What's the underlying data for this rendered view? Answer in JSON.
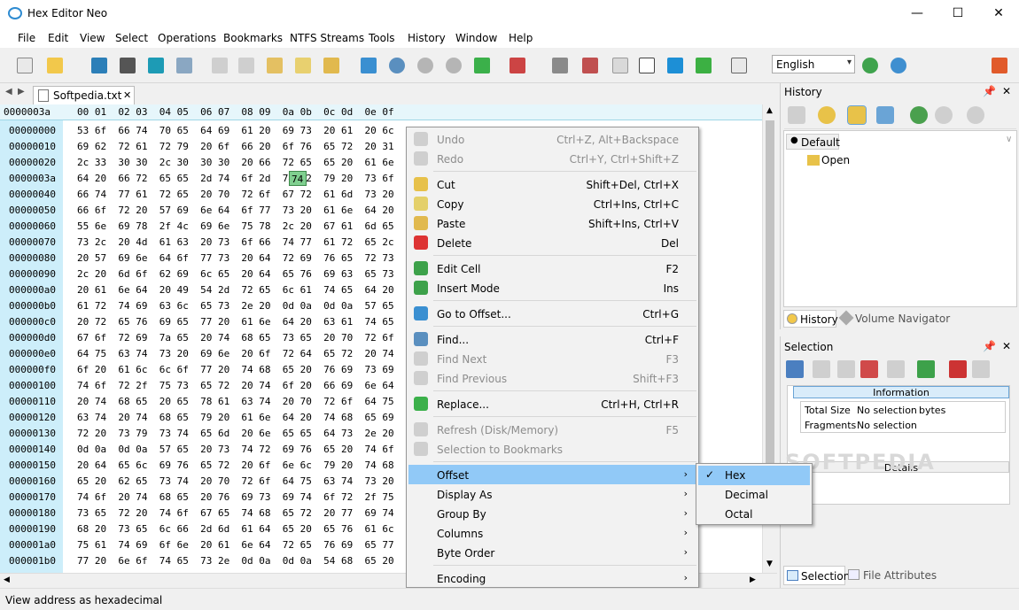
{
  "window": {
    "title": "Hex Editor Neo",
    "min": "—",
    "max": "☐",
    "close": "✕"
  },
  "menu": [
    "File",
    "Edit",
    "View",
    "Select",
    "Operations",
    "Bookmarks",
    "NTFS Streams",
    "Tools",
    "History",
    "Window",
    "Help"
  ],
  "toolbar": {
    "language": "English"
  },
  "tab": {
    "name": "Softpedia.txt",
    "close": "✕"
  },
  "hex_header": {
    "offset": "0000003a",
    "columns": "00 01  02 03  04 05  06 07  08 09  0a 0b  0c 0d  0e 0f"
  },
  "rows": [
    {
      "off": "00000000",
      "hex": "53 6f  66 74  70 65  64 69  61 20  69 73  20 61  20 6c"
    },
    {
      "off": "00000010",
      "hex": "69 62  72 61  72 79  20 6f  66 20  6f 76  65 72  20 31"
    },
    {
      "off": "00000020",
      "hex": "2c 33  30 30  2c 30  30 30  20 66  72 65  65 20  61 6e"
    },
    {
      "off": "0000003a",
      "hex": "64 20  66 72  65 65  2d 74  6f 2d  74 72  79 20  73 6f"
    },
    {
      "off": "00000040",
      "hex": "66 74  77 61  72 65  20 70  72 6f  67 72  61 6d  73 20"
    },
    {
      "off": "00000050",
      "hex": "66 6f  72 20  57 69  6e 64  6f 77  73 20  61 6e  64 20"
    },
    {
      "off": "00000060",
      "hex": "55 6e  69 78  2f 4c  69 6e  75 78  2c 20  67 61  6d 65"
    },
    {
      "off": "00000070",
      "hex": "73 2c  20 4d  61 63  20 73  6f 66  74 77  61 72  65 2c"
    },
    {
      "off": "00000080",
      "hex": "20 57  69 6e  64 6f  77 73  20 64  72 69  76 65  72 73"
    },
    {
      "off": "00000090",
      "hex": "2c 20  6d 6f  62 69  6c 65  20 64  65 76  69 63  65 73"
    },
    {
      "off": "000000a0",
      "hex": "20 61  6e 64  20 49  54 2d  72 65  6c 61  74 65  64 20"
    },
    {
      "off": "000000b0",
      "hex": "61 72  74 69  63 6c  65 73  2e 20  0d 0a  0d 0a  57 65"
    },
    {
      "off": "000000c0",
      "hex": "20 72  65 76  69 65  77 20  61 6e  64 20  63 61  74 65"
    },
    {
      "off": "000000d0",
      "hex": "67 6f  72 69  7a 65  20 74  68 65  73 65  20 70  72 6f"
    },
    {
      "off": "000000e0",
      "hex": "64 75  63 74  73 20  69 6e  20 6f  72 64  65 72  20 74"
    },
    {
      "off": "000000f0",
      "hex": "6f 20  61 6c  6c 6f  77 20  74 68  65 20  76 69  73 69"
    },
    {
      "off": "00000100",
      "hex": "74 6f  72 2f  75 73  65 72  20 74  6f 20  66 69  6e 64"
    },
    {
      "off": "00000110",
      "hex": "20 74  68 65  20 65  78 61  63 74  20 70  72 6f  64 75"
    },
    {
      "off": "00000120",
      "hex": "63 74  20 74  68 65  79 20  61 6e  64 20  74 68  65 69"
    },
    {
      "off": "00000130",
      "hex": "72 20  73 79  73 74  65 6d  20 6e  65 65  64 73  2e 20"
    },
    {
      "off": "00000140",
      "hex": "0d 0a  0d 0a  57 65  20 73  74 72  69 76  65 20  74 6f"
    },
    {
      "off": "00000150",
      "hex": "20 64  65 6c  69 76  65 72  20 6f  6e 6c  79 20  74 68"
    },
    {
      "off": "00000160",
      "hex": "65 20  62 65  73 74  20 70  72 6f  64 75  63 74  73 20"
    },
    {
      "off": "00000170",
      "hex": "74 6f  20 74  68 65  20 76  69 73  69 74  6f 72  2f 75"
    },
    {
      "off": "00000180",
      "hex": "73 65  72 20  74 6f  67 65  74 68  65 72  20 77  69 74"
    },
    {
      "off": "00000190",
      "hex": "68 20  73 65  6c 66  2d 6d  61 64  65 20  65 76  61 6c"
    },
    {
      "off": "000001a0",
      "hex": "75 61  74 69  6f 6e  20 61  6e 64  72 65  76 69  65 77"
    },
    {
      "off": "000001b0",
      "hex": "77 20  6e 6f  74 65  73 2e  0d 0a  0d 0a  54 68  65 20"
    }
  ],
  "selected_cell": "74",
  "context_menu": [
    {
      "label": "Undo",
      "shortcut": "Ctrl+Z, Alt+Backspace",
      "disabled": true
    },
    {
      "label": "Redo",
      "shortcut": "Ctrl+Y, Ctrl+Shift+Z",
      "disabled": true
    },
    {
      "label": "Cut",
      "shortcut": "Shift+Del, Ctrl+X"
    },
    {
      "label": "Copy",
      "shortcut": "Ctrl+Ins, Ctrl+C"
    },
    {
      "label": "Paste",
      "shortcut": "Shift+Ins, Ctrl+V"
    },
    {
      "label": "Delete",
      "shortcut": "Del"
    },
    {
      "label": "Edit Cell",
      "shortcut": "F2"
    },
    {
      "label": "Insert Mode",
      "shortcut": "Ins"
    },
    {
      "label": "Go to Offset...",
      "shortcut": "Ctrl+G"
    },
    {
      "label": "Find...",
      "shortcut": "Ctrl+F"
    },
    {
      "label": "Find Next",
      "shortcut": "F3",
      "disabled": true
    },
    {
      "label": "Find Previous",
      "shortcut": "Shift+F3",
      "disabled": true
    },
    {
      "label": "Replace...",
      "shortcut": "Ctrl+H, Ctrl+R"
    },
    {
      "label": "Refresh (Disk/Memory)",
      "shortcut": "F5",
      "disabled": true
    },
    {
      "label": "Selection to Bookmarks",
      "shortcut": "",
      "disabled": true
    },
    {
      "label": "Offset",
      "shortcut": "",
      "submenu": true,
      "highlighted": true
    },
    {
      "label": "Display As",
      "shortcut": "",
      "submenu": true
    },
    {
      "label": "Group By",
      "shortcut": "",
      "submenu": true
    },
    {
      "label": "Columns",
      "shortcut": "",
      "submenu": true
    },
    {
      "label": "Byte Order",
      "shortcut": "",
      "submenu": true
    },
    {
      "label": "Encoding",
      "shortcut": "",
      "submenu": true
    }
  ],
  "submenu": [
    {
      "label": "Hex",
      "checked": true
    },
    {
      "label": "Decimal"
    },
    {
      "label": "Octal"
    }
  ],
  "history_panel": {
    "title": "History",
    "tab": "Default",
    "item": "Open",
    "bottom_tabs": [
      "History",
      "Volume Navigator"
    ]
  },
  "selection_panel": {
    "title": "Selection",
    "info_header": "Information",
    "total_size_label": "Total Size",
    "total_size_value": "No selection",
    "total_size_unit": "bytes",
    "fragments_label": "Fragments",
    "fragments_value": "No selection",
    "details": "Details",
    "bottom_tabs": [
      "Selection",
      "File Attributes"
    ]
  },
  "watermark": "SOFTPEDIA",
  "status": "View address as hexadecimal",
  "colors": {
    "offset_bg": "#cdeefa",
    "highlight": "#91c9f7",
    "selected_cell": "#7fcf8f"
  }
}
